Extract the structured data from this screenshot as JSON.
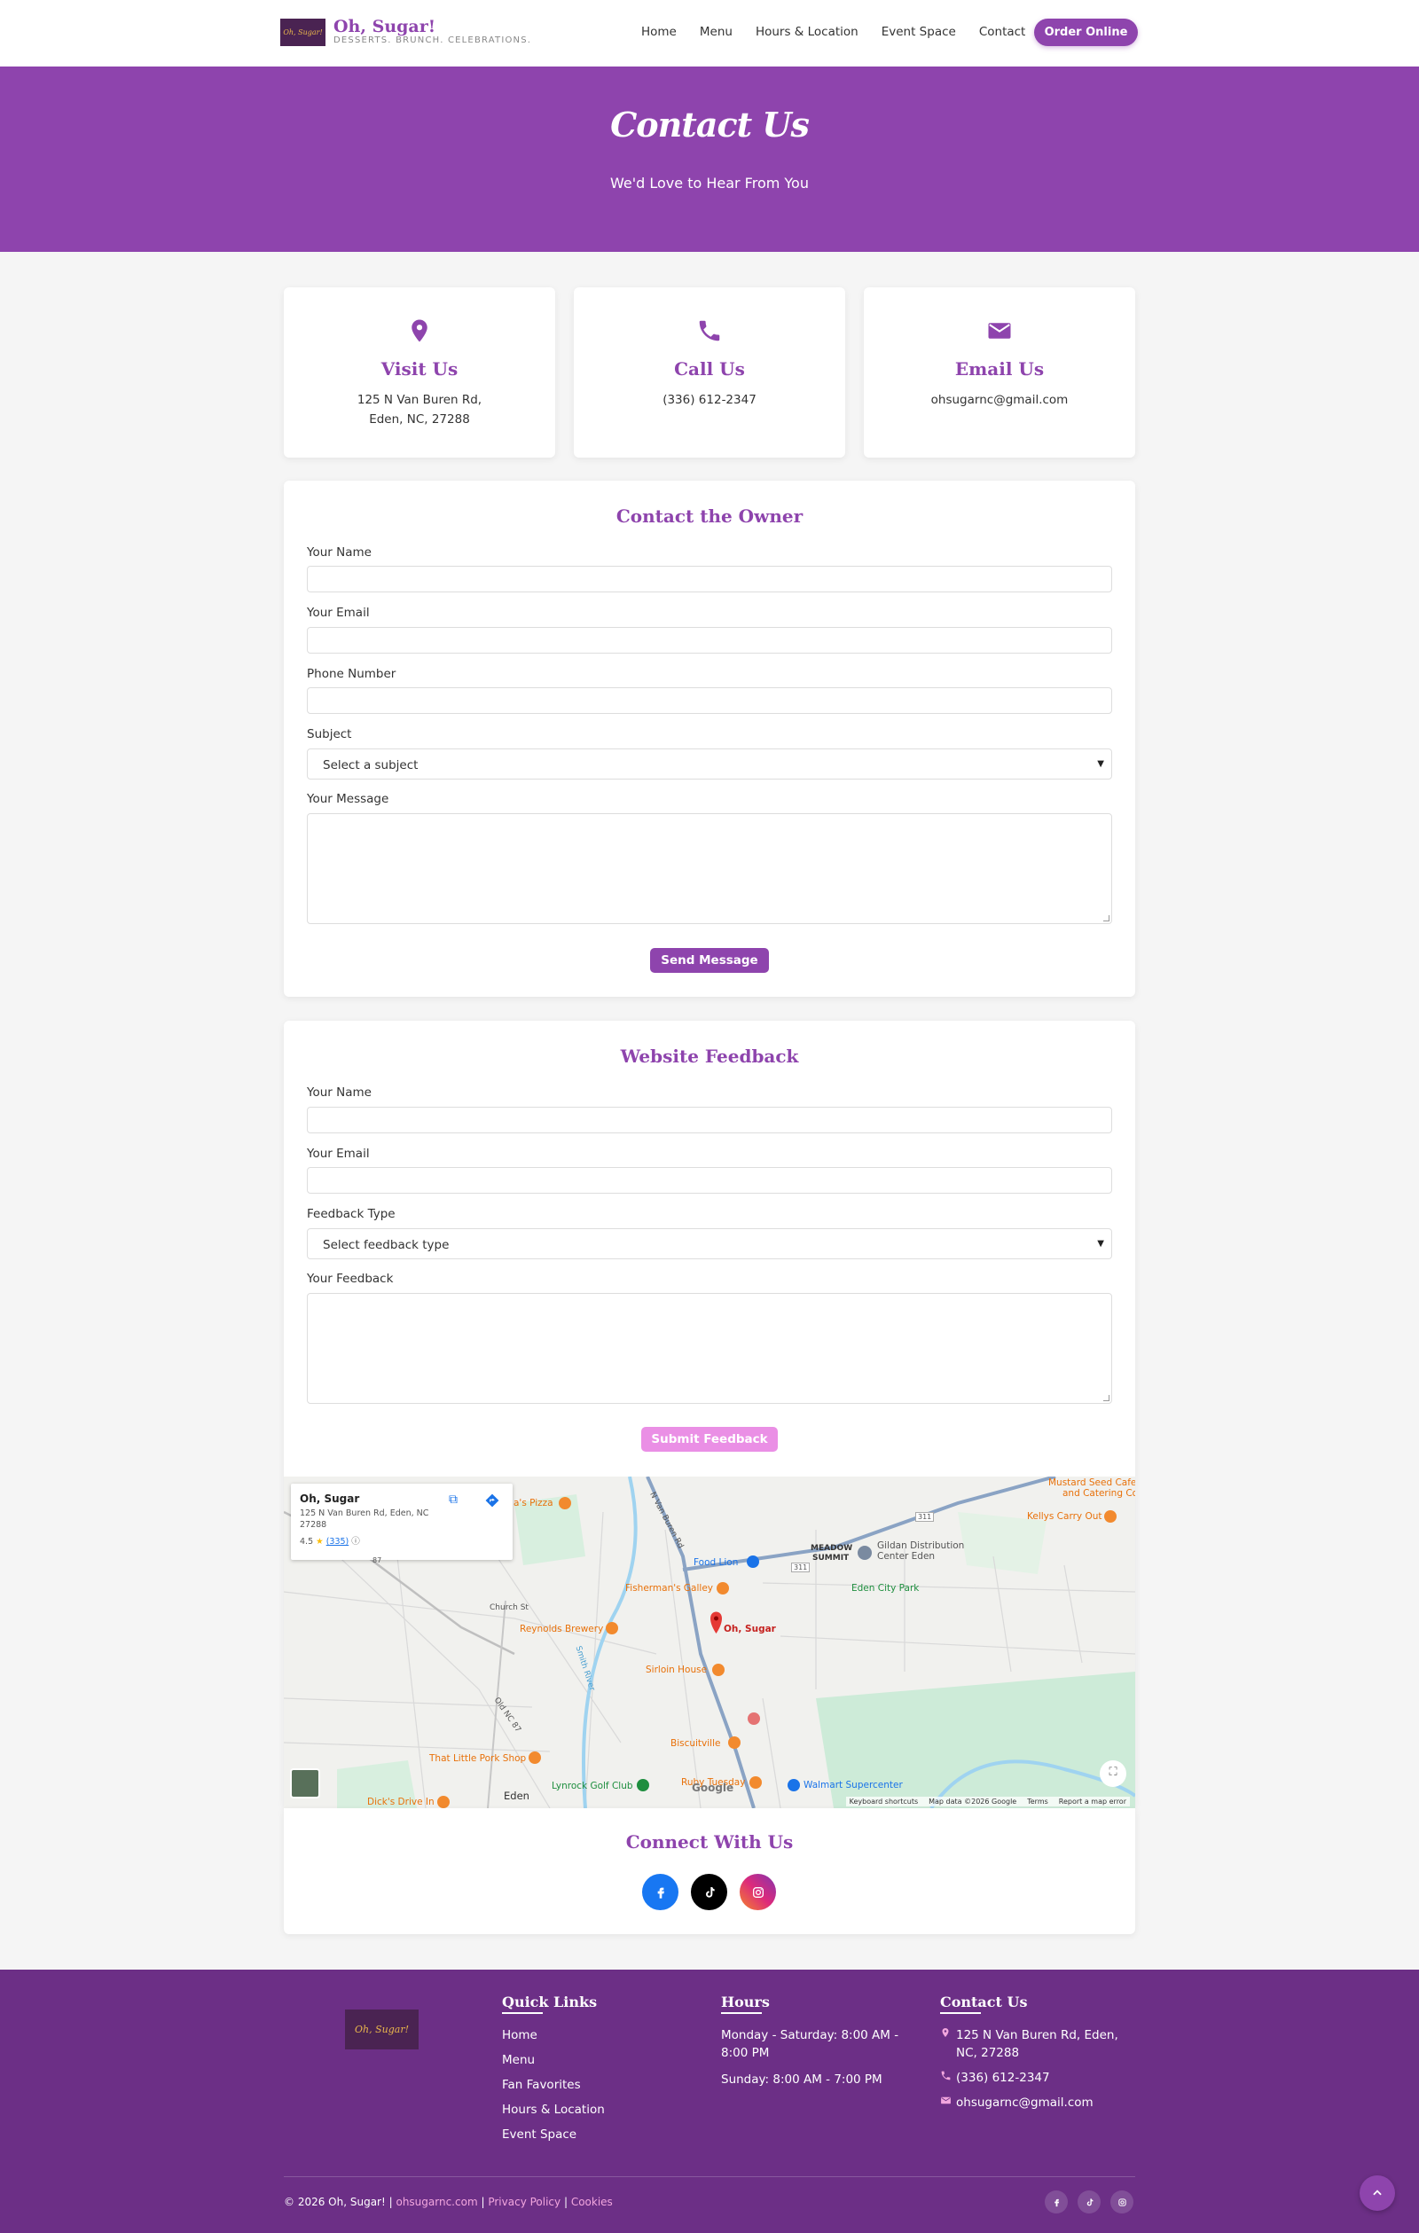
{
  "header": {
    "brand_name": "Oh, Sugar!",
    "brand_tagline": "DESSERTS. BRUNCH. CELEBRATIONS.",
    "logo_text": "Oh, Sugar!",
    "nav": [
      "Home",
      "Menu",
      "Hours & Location",
      "Event Space",
      "Contact"
    ],
    "order_button": "Order Online"
  },
  "hero": {
    "title": "Contact Us",
    "subtitle": "We'd Love to Hear From You"
  },
  "info_cards": [
    {
      "icon": "map-pin-icon",
      "title": "Visit Us",
      "line1": "125 N Van Buren Rd,",
      "line2": "Eden, NC, 27288"
    },
    {
      "icon": "phone-icon",
      "title": "Call Us",
      "line1": "(336) 612-2347",
      "line2": ""
    },
    {
      "icon": "envelope-icon",
      "title": "Email Us",
      "line1": "ohsugarnc@gmail.com",
      "line2": ""
    }
  ],
  "contact_form": {
    "title": "Contact the Owner",
    "name_label": "Your Name",
    "email_label": "Your Email",
    "phone_label": "Phone Number",
    "subject_label": "Subject",
    "subject_selected": "Select a subject",
    "message_label": "Your Message",
    "submit": "Send Message"
  },
  "feedback_form": {
    "title": "Website Feedback",
    "name_label": "Your Name",
    "email_label": "Your Email",
    "type_label": "Feedback Type",
    "type_selected": "Select feedback type",
    "feedback_label": "Your Feedback",
    "submit": "Submit Feedback"
  },
  "map": {
    "place_name": "Oh, Sugar",
    "place_address": "125 N Van Buren Rd, Eden, NC 27288",
    "rating": "4.5",
    "review_count": "(335)",
    "pin_label": "Oh, Sugar",
    "labels": {
      "pizza": "a's Pizza",
      "food_lion": "Food Lion",
      "fishermans": "Fisherman's Galley",
      "reynolds": "Reynolds Brewery",
      "sirloin": "Sirloin House",
      "biscuitville": "Biscuitville",
      "little_pork": "That Little Pork Shop",
      "lynrock": "Lynrock Golf Club",
      "ruby": "Ruby Tuesday",
      "walmart": "Walmart Supercenter",
      "dicks": "Dick's Drive In",
      "eden": "Eden",
      "meadow": "MEADOW",
      "summit": "SUMMIT",
      "gildan": "Gildan Distribution",
      "gildan2": "Center Eden",
      "eden_city_park": "Eden City Park",
      "kellys": "Kellys Carry Out",
      "mustard": "Mustard Seed Cafe",
      "mustard2": "and Catering Co",
      "church_st": "Church St",
      "old_nc": "Old NC 87",
      "van_buren_rd": "N Van Buren Rd",
      "smith_river": "Smith River",
      "route_a": "87",
      "route_b": "311",
      "route_c": "311",
      "google": "Google"
    },
    "attribution": [
      "Keyboard shortcuts",
      "Map data ©2026 Google",
      "Terms",
      "Report a map error"
    ]
  },
  "connect": {
    "title": "Connect With Us",
    "networks": [
      "facebook-icon",
      "tiktok-icon",
      "instagram-icon"
    ]
  },
  "footer": {
    "logo_text": "Oh, Sugar!",
    "quick_links_title": "Quick Links",
    "quick_links": [
      "Home",
      "Menu",
      "Fan Favorites",
      "Hours & Location",
      "Event Space"
    ],
    "hours_title": "Hours",
    "hours": [
      "Monday - Saturday: 8:00 AM - 8:00 PM",
      "Sunday: 8:00 AM - 7:00 PM"
    ],
    "contact_title": "Contact Us",
    "contact_address": "125 N Van Buren Rd, Eden, NC, 27288",
    "contact_phone": "(336) 612-2347",
    "contact_email": "ohsugarnc@gmail.com",
    "copyright": "© 2026 Oh, Sugar! |",
    "domain_link": "ohsugarnc.com",
    "sep": "|",
    "privacy": "Privacy Policy",
    "cookies": "Cookies"
  },
  "colors": {
    "brand_purple": "#8e44ad",
    "footer_purple": "#6c2f86",
    "feedback_button_pink": "#ea8fe5",
    "facebook_blue": "#1877f2",
    "tiktok_black": "#000000"
  }
}
